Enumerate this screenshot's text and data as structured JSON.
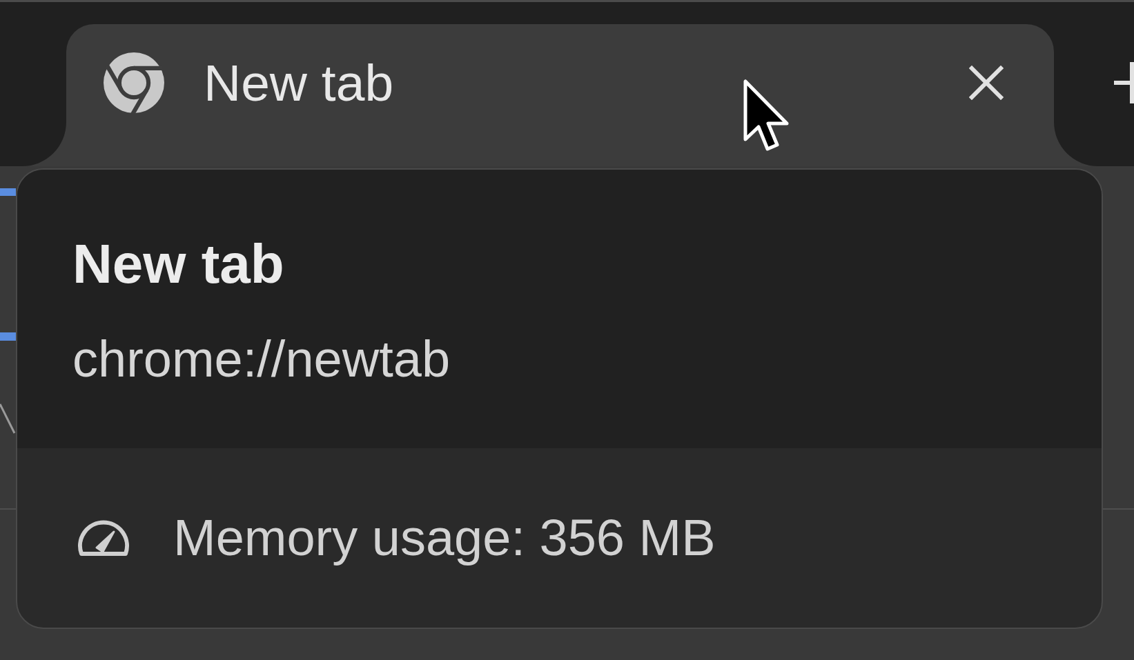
{
  "tabs": [
    {
      "title": "New tab",
      "selected": true
    }
  ],
  "hover_card": {
    "title": "New tab",
    "url": "chrome://newtab",
    "memory_usage": "Memory usage: 356 MB"
  }
}
